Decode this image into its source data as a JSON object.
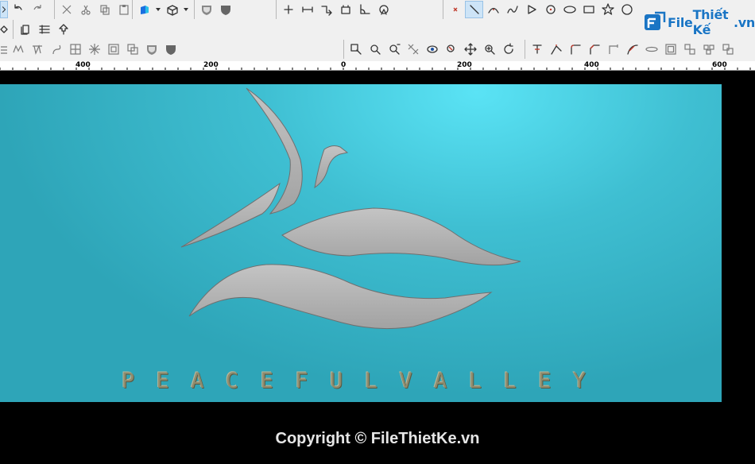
{
  "toolbar": {
    "row1_left": [
      "save-icon",
      "undo-icon",
      "redo-icon",
      "cut-icon",
      "scissors-icon",
      "copy-icon",
      "paste-icon",
      "cube-icon",
      "box3d-icon",
      "shield-icon",
      "shield-filled-icon"
    ],
    "row1_mid": [
      "crosshair-icon",
      "dimension-icon",
      "snap-icon",
      "measure-icon",
      "angle-icon",
      "rotate-view-icon"
    ],
    "row1_right": [
      "delete-icon",
      "line-icon",
      "arc-icon",
      "polyline-icon",
      "triangle-icon",
      "circle-point-icon",
      "ellipse-icon",
      "rectangle-icon",
      "star-icon",
      "circle-icon"
    ],
    "row2": [
      "diamond-icon",
      "layers-icon",
      "grid-icon",
      "tree-icon"
    ],
    "row3_left": [
      "mesh-icon",
      "curve-icon",
      "spline-icon",
      "twist-icon",
      "grid-box-icon",
      "burst-icon",
      "offset-icon",
      "union-icon",
      "shield-icon",
      "shield-filled-icon"
    ],
    "row3_right": [
      "zoom-box-icon",
      "zoom-in-icon",
      "zoom-out-icon",
      "zoom-fit-icon",
      "eye-icon",
      "zoom-select-icon",
      "pan-icon",
      "zoom-icon",
      "refresh-icon",
      "trim-icon",
      "extend-icon",
      "fillet-icon",
      "chamfer-icon",
      "corner-icon",
      "blend-icon",
      "slot-icon",
      "offset-rect-icon",
      "copy-shape-icon",
      "array-icon",
      "merge-icon"
    ]
  },
  "logo": {
    "brand": "File",
    "suffix": "Thiết Kế",
    "tld": ".vn"
  },
  "ruler": {
    "labels": [
      "400",
      "200",
      "0",
      "200",
      "400",
      "600"
    ]
  },
  "canvas": {
    "background_color": "#000000",
    "artboard_color": "#3fbfd2",
    "text_letters": [
      "P",
      "E",
      "A",
      "C",
      "E",
      "F",
      "U",
      "L",
      "V",
      "A",
      "L",
      "L",
      "E",
      "Y"
    ]
  },
  "footer": {
    "copyright": "Copyright © FileThietKe.vn"
  }
}
